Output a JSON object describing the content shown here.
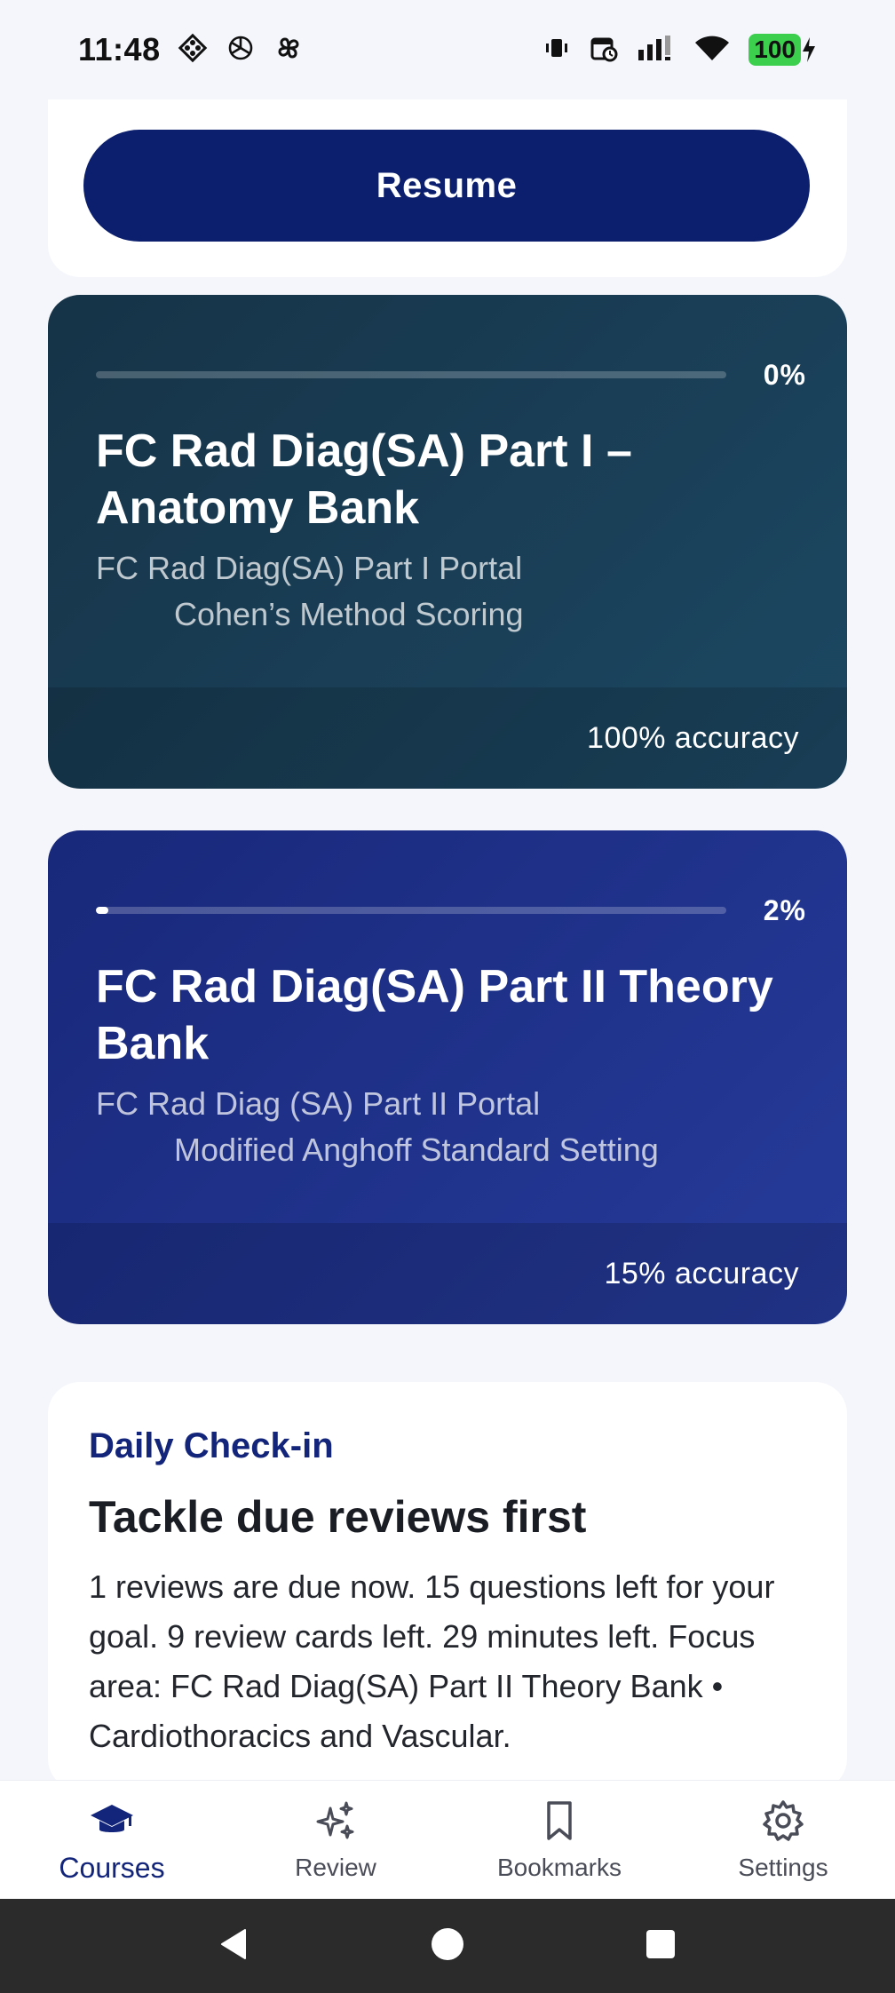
{
  "status_bar": {
    "time": "11:48",
    "battery": "100",
    "left_icons": [
      "diamond-grid-icon",
      "openai-icon",
      "pinwheel-icon"
    ],
    "right_icons": [
      "vibrate-icon",
      "calendar-clock-icon",
      "signal-icon",
      "wifi-icon",
      "battery-icon"
    ]
  },
  "resume": {
    "label": "Resume"
  },
  "courses": [
    {
      "progress_label": "0%",
      "progress_value": 0,
      "title": "FC Rad Diag(SA) Part I – Anatomy Bank",
      "portal": "FC Rad Diag(SA) Part I Portal",
      "scoring": "Cohen’s Method Scoring",
      "accuracy": "100% accuracy"
    },
    {
      "progress_label": "2%",
      "progress_value": 0.02,
      "title": "FC Rad Diag(SA) Part II Theory Bank",
      "portal": "FC Rad Diag (SA) Part II Portal",
      "scoring": "Modified Anghoff Standard Setting",
      "accuracy": "15% accuracy"
    }
  ],
  "checkin": {
    "kicker": "Daily Check-in",
    "title": "Tackle due reviews first",
    "body": "1 reviews are due now. 15 questions left for your goal. 9 review cards left. 29 minutes left. Focus area: FC Rad Diag(SA) Part II Theory Bank • Cardiothoracics and Vascular."
  },
  "nav": {
    "items": [
      {
        "label": "Courses",
        "icon": "graduation-cap-icon",
        "active": true
      },
      {
        "label": "Review",
        "icon": "sparkles-icon",
        "active": false
      },
      {
        "label": "Bookmarks",
        "icon": "bookmark-icon",
        "active": false
      },
      {
        "label": "Settings",
        "icon": "gear-icon",
        "active": false
      }
    ]
  },
  "colors": {
    "primary": "#0b1f6e",
    "card1": "#163347",
    "card2": "#18287a",
    "active_nav": "#13257a",
    "battery": "#3ccf4e"
  }
}
